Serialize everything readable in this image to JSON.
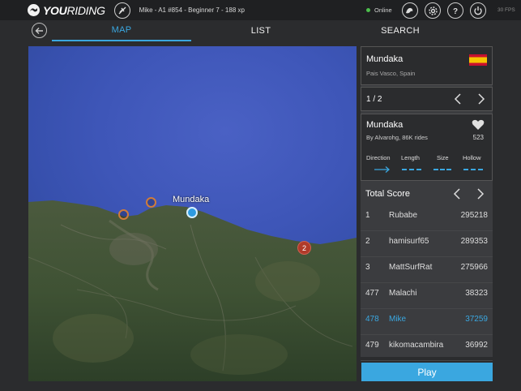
{
  "app": {
    "name_bold": "YOU",
    "name_rest": "RIDING",
    "user_info": "Mike - A1 #854 - Beginner 7 - 188 xp",
    "status": "Online",
    "fps": "30 FPS"
  },
  "tabs": [
    {
      "label": "MAP",
      "active": true
    },
    {
      "label": "LIST",
      "active": false
    },
    {
      "label": "SEARCH",
      "active": false
    }
  ],
  "map": {
    "label": "Mundaka",
    "cluster_count": "2"
  },
  "spot": {
    "name": "Mundaka",
    "region": "Pais Vasco, Spain",
    "flag": "spain-flag-icon"
  },
  "pager": {
    "text": "1 / 2"
  },
  "wave": {
    "name": "Mundaka",
    "by": "By Alvarohg, 86K rides",
    "likes": "523",
    "metrics": [
      "Direction",
      "Length",
      "Size",
      "Hollow"
    ]
  },
  "score": {
    "title": "Total Score",
    "rows": [
      {
        "rank": "1",
        "name": "Rubabe",
        "points": "295218"
      },
      {
        "rank": "2",
        "name": "hamisurf65",
        "points": "289353"
      },
      {
        "rank": "3",
        "name": "MattSurfRat",
        "points": "275966"
      },
      {
        "rank": "477",
        "name": "Malachi",
        "points": "38323"
      },
      {
        "rank": "478",
        "name": "Mike",
        "points": "37259"
      },
      {
        "rank": "479",
        "name": "kikomacambira",
        "points": "36992"
      }
    ]
  },
  "play": {
    "label": "Play"
  },
  "colors": {
    "accent": "#3aa7e0",
    "background": "#2b2c2e",
    "cluster": "#b03a2a",
    "marker_orange": "#d07c3a"
  }
}
